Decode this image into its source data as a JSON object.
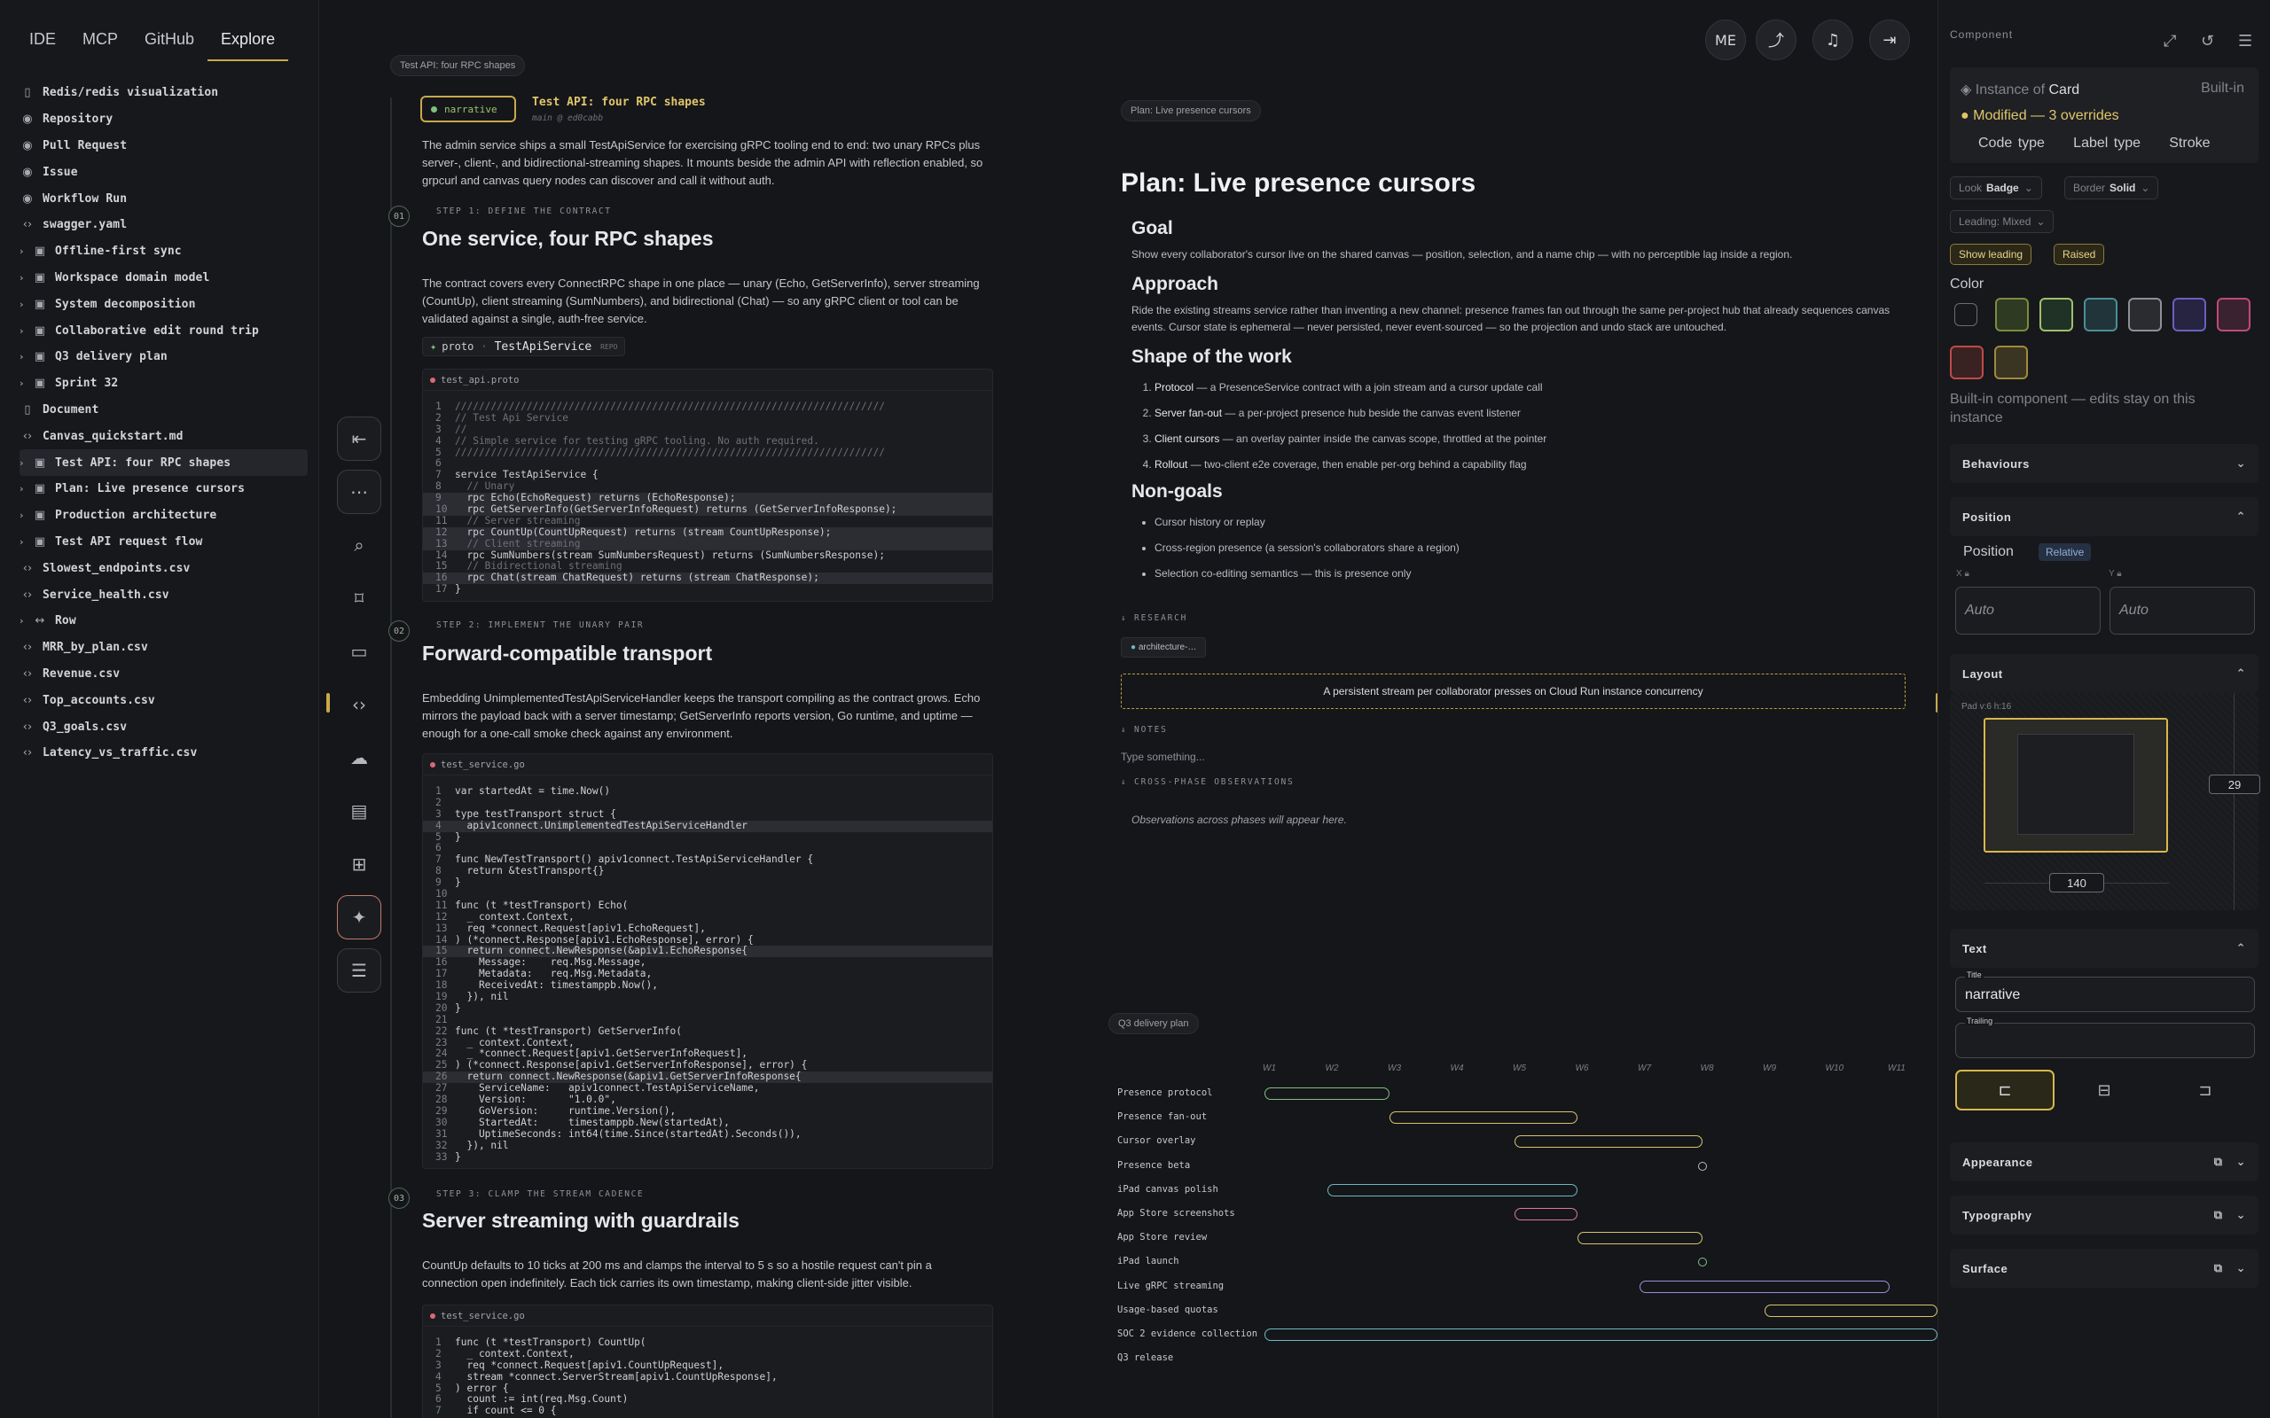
{
  "nav": {
    "tabs": [
      "IDE",
      "MCP",
      "GitHub",
      "Explore"
    ]
  },
  "tree": [
    {
      "icon": "doc",
      "label": "Redis/redis visualization"
    },
    {
      "icon": "github",
      "label": "Repository"
    },
    {
      "icon": "github",
      "label": "Pull Request"
    },
    {
      "icon": "github",
      "label": "Issue"
    },
    {
      "icon": "github",
      "label": "Workflow Run"
    },
    {
      "icon": "code",
      "label": "swagger.yaml"
    },
    {
      "icon": "folder",
      "label": "Offline-first sync",
      "chev": true
    },
    {
      "icon": "folder",
      "label": "Workspace domain model",
      "chev": true
    },
    {
      "icon": "folder",
      "label": "System decomposition",
      "chev": true
    },
    {
      "icon": "folder",
      "label": "Collaborative edit round trip",
      "chev": true
    },
    {
      "icon": "folder",
      "label": "Q3 delivery plan",
      "chev": true
    },
    {
      "icon": "folder",
      "label": "Sprint 32",
      "chev": true
    },
    {
      "icon": "doc",
      "label": "Document"
    },
    {
      "icon": "code",
      "label": "Canvas_quickstart.md"
    },
    {
      "icon": "folder",
      "label": "Test API: four RPC shapes",
      "chev": true,
      "selected": true
    },
    {
      "icon": "folder",
      "label": "Plan: Live presence cursors",
      "chev": true
    },
    {
      "icon": "folder",
      "label": "Production architecture",
      "chev": true
    },
    {
      "icon": "folder",
      "label": "Test API request flow",
      "chev": true
    },
    {
      "icon": "code",
      "label": "Slowest_endpoints.csv"
    },
    {
      "icon": "code",
      "label": "Service_health.csv"
    },
    {
      "icon": "row",
      "label": "Row",
      "chev": true
    },
    {
      "icon": "code",
      "label": "MRR_by_plan.csv"
    },
    {
      "icon": "code",
      "label": "Revenue.csv"
    },
    {
      "icon": "code",
      "label": "Top_accounts.csv"
    },
    {
      "icon": "code",
      "label": "Q3_goals.csv"
    },
    {
      "icon": "code",
      "label": "Latency_vs_traffic.csv"
    }
  ],
  "doc": {
    "crumb": "Test API: four RPC shapes",
    "chip": "narrative",
    "title": "Test API: four RPC shapes",
    "subtitle": "main @ ed0cabb",
    "intro": "The admin service ships a small TestApiService for exercising gRPC tooling end to end: two unary RPCs plus server-, client-, and bidirectional-streaming shapes. It mounts beside the admin API with reflection enabled, so grpcurl and canvas query nodes can discover and call it without auth.",
    "steps": [
      {
        "num": "01",
        "label": "STEP 1: DEFINE THE CONTRACT",
        "title": "One service, four RPC shapes",
        "body": "The contract covers every ConnectRPC shape in one place — unary (Echo, GetServerInfo), server streaming (CountUp), client streaming (SumNumbers), and bidirectional (Chat) — so any gRPC client or tool can be validated against a single, auth-free service."
      },
      {
        "num": "",
        "label": "STEP 2: IMPLEMENT THE UNARY PAIR",
        "title": "Forward-compatible transport",
        "body": "Embedding UnimplementedTestApiServiceHandler keeps the transport compiling as the contract grows. Echo mirrors the payload back with a server timestamp; GetServerInfo reports version, Go runtime, and uptime — enough for a one-call smoke check against any environment."
      },
      {
        "num": "03",
        "label": "STEP 3: CLAMP THE STREAM CADENCE",
        "title": "Server streaming with guardrails",
        "body": "CountUp defaults to 10 ticks at 200 ms and clamps the interval to 5 s so a hostile request can't pin a connection open indefinitely. Each tick carries its own timestamp, making client-side jitter visible."
      }
    ],
    "proto_tag": {
      "lang": "proto",
      "name": "TestApiService",
      "badge": "REPO"
    },
    "files": [
      "test_api.proto",
      "test_service.go",
      "test_service.go"
    ],
    "proto_lines": [
      "////////////////////////////////////////////////////////////////////////",
      "// Test Api Service",
      "//",
      "// Simple service for testing gRPC tooling. No auth required.",
      "////////////////////////////////////////////////////////////////////////",
      "",
      "service TestApiService {",
      "  // Unary",
      "  rpc Echo(EchoRequest) returns (EchoResponse);",
      "  rpc GetServerInfo(GetServerInfoRequest) returns (GetServerInfoResponse);",
      "  // Server streaming",
      "  rpc CountUp(CountUpRequest) returns (stream CountUpResponse);",
      "  // Client streaming",
      "  rpc SumNumbers(stream SumNumbersRequest) returns (SumNumbersResponse);",
      "  // Bidirectional streaming",
      "  rpc Chat(stream ChatRequest) returns (stream ChatResponse);",
      "}"
    ],
    "go_lines": [
      "var startedAt = time.Now()",
      "",
      "type testTransport struct {",
      "  apiv1connect.UnimplementedTestApiServiceHandler",
      "}",
      "",
      "func NewTestTransport() apiv1connect.TestApiServiceHandler {",
      "  return &testTransport{}",
      "}",
      "",
      "func (t *testTransport) Echo(",
      "  _ context.Context,",
      "  req *connect.Request[apiv1.EchoRequest],",
      ") (*connect.Response[apiv1.EchoResponse], error) {",
      "  return connect.NewResponse(&apiv1.EchoResponse{",
      "    Message:    req.Msg.Message,",
      "    Metadata:   req.Msg.Metadata,",
      "    ReceivedAt: timestamppb.Now(),",
      "  }), nil",
      "}",
      "",
      "func (t *testTransport) GetServerInfo(",
      "  _ context.Context,",
      "  _ *connect.Request[apiv1.GetServerInfoRequest],",
      ") (*connect.Response[apiv1.GetServerInfoResponse], error) {",
      "  return connect.NewResponse(&apiv1.GetServerInfoResponse{",
      "    ServiceName:   apiv1connect.TestApiServiceName,",
      "    Version:       \"1.0.0\",",
      "    GoVersion:     runtime.Version(),",
      "    StartedAt:     timestamppb.New(startedAt),",
      "    UptimeSeconds: int64(time.Since(startedAt).Seconds()),",
      "  }), nil",
      "}"
    ],
    "count_lines": [
      "func (t *testTransport) CountUp(",
      "  _ context.Context,",
      "  req *connect.Request[apiv1.CountUpRequest],",
      "  stream *connect.ServerStream[apiv1.CountUpResponse],",
      ") error {",
      "  count := int(req.Msg.Count)",
      "  if count <= 0 {"
    ]
  },
  "topbar": {
    "avatar": "ME"
  },
  "plan": {
    "crumb": "Plan: Live presence cursors",
    "title": "Plan: Live presence cursors",
    "goal_h": "Goal",
    "goal": "Show every collaborator's cursor live on the shared canvas — position, selection, and a name chip — with no perceptible lag inside a region.",
    "approach_h": "Approach",
    "approach": "Ride the existing streams service rather than inventing a new channel: presence frames fan out through the same per-project hub that already sequences canvas events. Cursor state is ephemeral — never persisted, never event-sourced — so the projection and undo stack are untouched.",
    "shape_h": "Shape of the work",
    "shape": [
      {
        "b": "Protocol",
        "t": " — a PresenceService contract with a join stream and a cursor update call"
      },
      {
        "b": "Server fan-out",
        "t": " — a per-project presence hub beside the canvas event listener"
      },
      {
        "b": "Client cursors",
        "t": " — an overlay painter inside the canvas scope, throttled at the pointer"
      },
      {
        "b": "Rollout",
        "t": " — two-client e2e coverage, then enable per-org behind a capability flag"
      }
    ],
    "nongoals_h": "Non-goals",
    "nongoals": [
      "Cursor history or replay",
      "Cross-region presence (a session's collaborators share a region)",
      "Selection co-editing semantics — this is presence only"
    ],
    "research_label": "RESEARCH",
    "research_chip": "architecture-…",
    "callout": "A persistent stream per collaborator presses on Cloud Run instance concurrency",
    "notes_label": "NOTES",
    "notes_placeholder": "Type something...",
    "obs_label": "CROSS-PHASE OBSERVATIONS",
    "obs": "Observations across phases will appear here."
  },
  "gantt": {
    "crumb": "Q3 delivery plan",
    "weeks": [
      "W1",
      "W2",
      "W3",
      "W4",
      "W5",
      "W6",
      "W7",
      "W8",
      "W9",
      "W10",
      "W11"
    ],
    "rows": [
      {
        "label": "Presence protocol",
        "start": 1,
        "end": 3,
        "color": "#7fbf7f"
      },
      {
        "label": "Presence fan-out",
        "start": 3,
        "end": 6,
        "color": "#d8c46a"
      },
      {
        "label": "Cursor overlay",
        "start": 5,
        "end": 8,
        "color": "#d8c46a"
      },
      {
        "label": "Presence beta",
        "milestone": 8,
        "color": "#b9bcc2"
      },
      {
        "label": "iPad canvas polish",
        "start": 2,
        "end": 6,
        "color": "#6fb8c0"
      },
      {
        "label": "App Store screenshots",
        "start": 5,
        "end": 6,
        "color": "#d97a9a"
      },
      {
        "label": "App Store review",
        "start": 6,
        "end": 8,
        "color": "#d8c46a"
      },
      {
        "label": "iPad launch",
        "milestone": 8,
        "color": "#7fbf7f"
      },
      {
        "label": "Live gRPC streaming",
        "start": 7,
        "end": 11,
        "color": "#9a8ed8"
      },
      {
        "label": "Usage-based quotas",
        "start": 9,
        "end": 12.5,
        "color": "#d8c46a"
      },
      {
        "label": "SOC 2 evidence collection",
        "start": 1,
        "end": 12.5,
        "color": "#6fb8c0"
      },
      {
        "label": "Q3 release"
      }
    ]
  },
  "panel": {
    "header": "Component",
    "instance_prefix": "Instance of",
    "instance_name": "Card",
    "builtin": "Built-in",
    "modified": "Modified — 3 overrides",
    "overrides": [
      "Code type",
      "Label type",
      "Stroke"
    ],
    "look_label": "Look",
    "look_value": "Badge",
    "border_label": "Border",
    "border_value": "Solid",
    "leading_label": "Leading: Mixed",
    "show_leading": "Show leading",
    "raised": "Raised",
    "color_label": "Color",
    "swatches": [
      {
        "fill": "#2e3a22",
        "border": "#7d8c3c"
      },
      {
        "fill": "#203226",
        "border": "#9fc06a"
      },
      {
        "fill": "#20343a",
        "border": "#4a8f96"
      },
      {
        "fill": "#2a2c30",
        "border": "#8d9096"
      },
      {
        "fill": "#262440",
        "border": "#6a60c0"
      },
      {
        "fill": "#3a2230",
        "border": "#c04a78"
      },
      {
        "fill": "#3a2222",
        "border": "#c04a48"
      },
      {
        "fill": "#3a3422",
        "border": "#a08a3a"
      }
    ],
    "note": "Built-in component — edits stay on this instance",
    "sections": [
      "Behaviours",
      "Position",
      "Layout",
      "Text",
      "Appearance",
      "Typography",
      "Surface"
    ],
    "position_label": "Position",
    "position_value": "Relative",
    "x_label": "X",
    "y_label": "Y",
    "x_value": "Auto",
    "y_value": "Auto",
    "pad_label": "Pad v:6 h:16",
    "layout_w": "140",
    "layout_h": "29",
    "title_label": "Title",
    "title_value": "narrative",
    "trailing_label": "Trailing",
    "trailing_value": ""
  },
  "colors": {
    "accent": "#c9a94a",
    "bg": "#15161a"
  }
}
